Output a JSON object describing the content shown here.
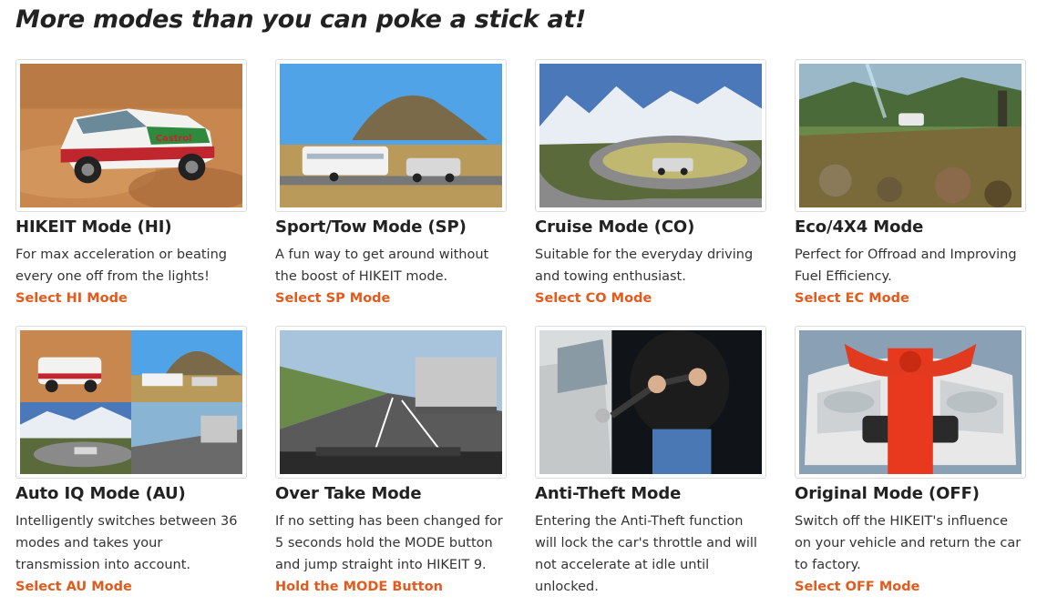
{
  "heading": "More modes than you can poke a stick at!",
  "colors": {
    "link": "#e25a1c",
    "heading": "#222222",
    "text": "#333333"
  },
  "modes": [
    {
      "title": "HIKEIT Mode (HI)",
      "description": "For max acceleration or beating every one off from the lights!",
      "link": "Select HI Mode",
      "image": "rally-car-image"
    },
    {
      "title": "Sport/Tow Mode (SP)",
      "description": "A fun way to get around without the boost of HIKEIT mode.",
      "link": "Select SP Mode",
      "image": "caravan-tow-image"
    },
    {
      "title": "Cruise Mode (CO)",
      "description": "Suitable for the everyday driving and towing enthusiast.",
      "link": "Select CO Mode",
      "image": "mountain-road-image"
    },
    {
      "title": "Eco/4X4 Mode",
      "description": "Perfect for Offroad and Improving Fuel Efficiency.",
      "link": "Select EC Mode",
      "image": "offroad-image"
    },
    {
      "title": "Auto IQ Mode (AU)",
      "description": "Intelligently switches between 36 modes and takes your transmission into account.",
      "link": "Select AU Mode",
      "image": "collage-image"
    },
    {
      "title": "Over Take Mode",
      "description": "If no setting has been changed for 5 seconds hold the MODE button and jump straight into HIKEIT 9.",
      "link": "Hold the MODE Button",
      "image": "highway-truck-image"
    },
    {
      "title": "Anti-Theft Mode",
      "description": "Entering the Anti-Theft function will lock the car's throttle and will not accelerate at idle until unlocked.",
      "link": "",
      "image": "steering-lock-image"
    },
    {
      "title": "Original Mode (OFF)",
      "description": "Switch off the HIKEIT's influence on your vehicle and return the car to factory.",
      "link": "Select OFF Mode",
      "image": "gift-car-image"
    }
  ]
}
